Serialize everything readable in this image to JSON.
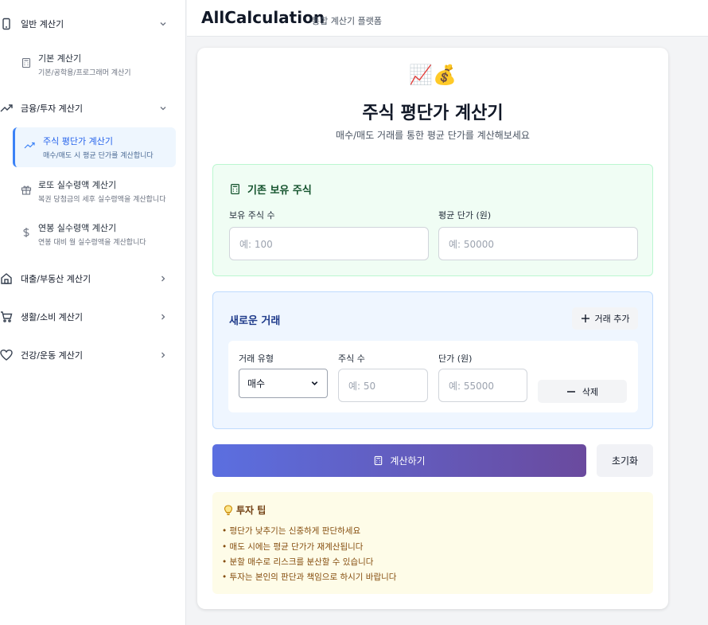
{
  "app": {
    "brand": "AllCalculation",
    "brand_sub": "통합 계산기 플랫폼"
  },
  "sidebar": {
    "categories": [
      {
        "label": "일반 계산기",
        "icon": "smartphone-icon",
        "expanded": true
      },
      {
        "label": "금융/투자 계산기",
        "icon": "trending-up-icon",
        "expanded": true
      },
      {
        "label": "대출/부동산 계산기",
        "icon": "home-icon",
        "expanded": false
      },
      {
        "label": "생활/소비 계산기",
        "icon": "cart-icon",
        "expanded": false
      },
      {
        "label": "건강/운동 계산기",
        "icon": "heart-icon",
        "expanded": false
      }
    ],
    "items": [
      {
        "title": "기본 계산기",
        "desc": "기본/공학용/프로그래머 계산기",
        "icon": "calculator-icon"
      },
      {
        "title": "주식 평단가 계산기",
        "desc": "매수/매도 시 평균 단가를 계산합니다",
        "icon": "trending-up-icon",
        "active": true
      },
      {
        "title": "로또 실수령액 계산기",
        "desc": "복권 당첨금의 세후 실수령액을 계산합니다",
        "icon": "gift-icon"
      },
      {
        "title": "연봉 실수령액 계산기",
        "desc": "연봉 대비 월 실수령액을 계산합니다",
        "icon": "dollar-icon"
      }
    ]
  },
  "main": {
    "emoji": "📈💰",
    "title": "주식 평단가 계산기",
    "subtitle": "매수/매도 거래를 통한 평균 단가를 계산해보세요",
    "holdings": {
      "title": "기존 보유 주식",
      "shares_label": "보유 주식 수",
      "shares_placeholder": "예: 100",
      "price_label": "평균 단가 (원)",
      "price_placeholder": "예: 50000"
    },
    "trade": {
      "title": "새로운 거래",
      "add_label": "거래 추가",
      "type_label": "거래 유형",
      "type_value": "매수",
      "qty_label": "주식 수",
      "qty_placeholder": "예: 50",
      "price_label": "단가 (원)",
      "price_placeholder": "예: 55000",
      "delete_label": "삭제"
    },
    "calculate_label": "계산하기",
    "reset_label": "초기화",
    "tips": {
      "title": "투자 팁",
      "items": [
        "• 평단가 낮추기는 신중하게 판단하세요",
        "• 매도 시에는 평균 단가가 재계산됩니다",
        "• 분할 매수로 리스크를 분산할 수 있습니다",
        "• 투자는 본인의 판단과 책임으로 하시기 바랍니다"
      ]
    }
  },
  "colors": {
    "accent": "#3b82f6",
    "calc_gradient_start": "#5b6fe0",
    "calc_gradient_end": "#6a4a9e",
    "holdings_bg": "#f0fdf4",
    "trade_bg": "#eff6ff",
    "tips_bg": "#fefce8"
  }
}
